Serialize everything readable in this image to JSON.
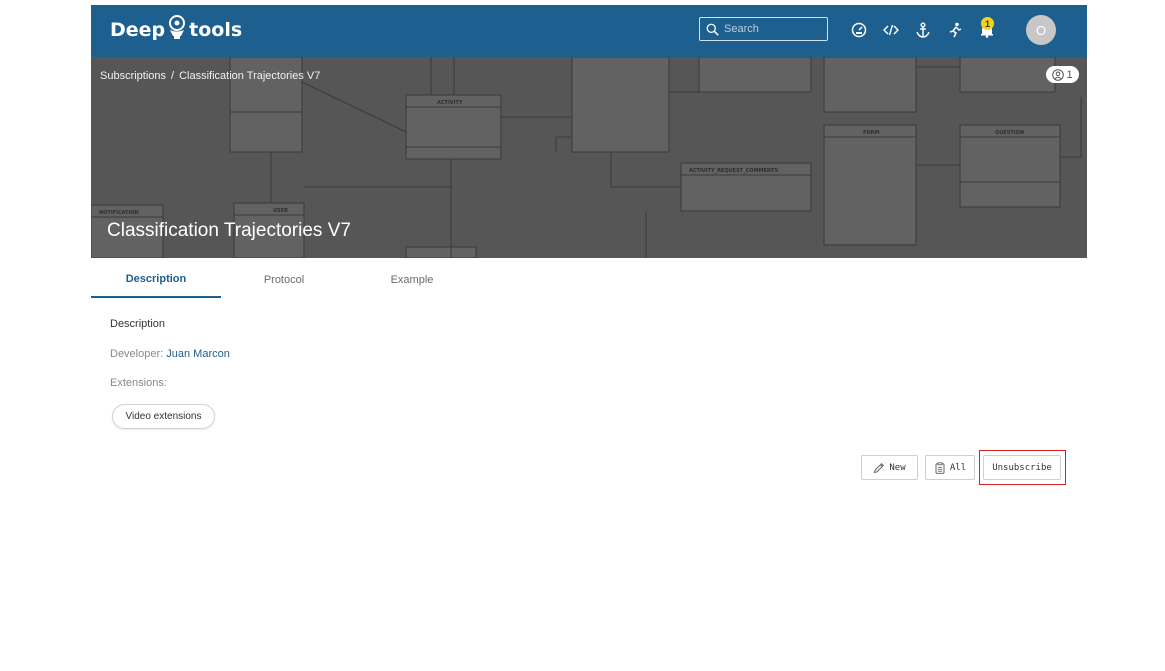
{
  "app": {
    "logo_left": "Deep",
    "logo_right": "tools",
    "search_placeholder": "Search",
    "notification_count": "1",
    "avatar_initial": "O"
  },
  "banner": {
    "breadcrumb": {
      "root": "Subscriptions",
      "separator": "/",
      "current": "Classification Trajectories V7"
    },
    "subscribers_count": "1",
    "title": "Classification Trajectories V7",
    "diagram_labels": [
      "ACTIVITY",
      "USER",
      "NOTIFICATION",
      "FORM",
      "QUESTION",
      "ACTIVITY_REQUEST_COMMENTS"
    ]
  },
  "tabs": [
    {
      "label": "Description",
      "active": true
    },
    {
      "label": "Protocol",
      "active": false
    },
    {
      "label": "Example",
      "active": false
    }
  ],
  "content": {
    "section_title": "Description",
    "developer_label": "Developer:",
    "developer_name": "Juan Marcon",
    "extensions_label": "Extensions:",
    "extension_chip": "Video extensions"
  },
  "actions": {
    "new_label": "New",
    "all_label": "All",
    "unsubscribe_label": "Unsubscribe"
  },
  "colors": {
    "header": "#1d5f8f",
    "banner": "#565656",
    "badge": "#f4d21f",
    "highlight": "#d32020"
  }
}
